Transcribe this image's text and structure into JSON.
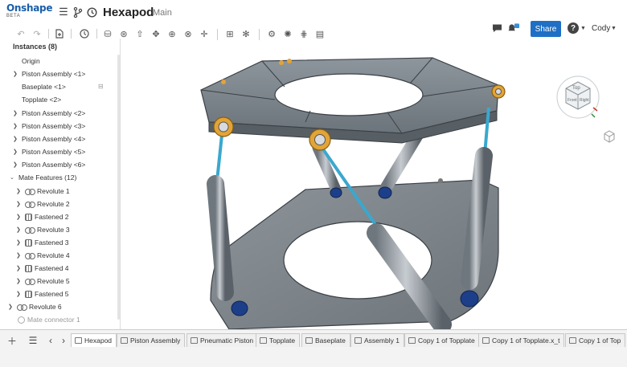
{
  "app": {
    "logo_name": "Onshape",
    "logo_badge": "BETA",
    "document_title": "Hexapod",
    "workspace": "Main",
    "share_label": "Share",
    "user_name": "Cody",
    "accent_color": "#1f6fc5"
  },
  "panel": {
    "header": "Instances (8)",
    "instances": [
      {
        "label": "Origin",
        "expandable": false
      },
      {
        "label": "Piston Assembly <1>",
        "expandable": true
      },
      {
        "label": "Baseplate <1>",
        "expandable": false
      },
      {
        "label": "Topplate <2>",
        "expandable": false
      },
      {
        "label": "Piston Assembly <2>",
        "expandable": true
      },
      {
        "label": "Piston Assembly <3>",
        "expandable": true
      },
      {
        "label": "Piston Assembly <4>",
        "expandable": true
      },
      {
        "label": "Piston Assembly <5>",
        "expandable": true
      },
      {
        "label": "Piston Assembly <6>",
        "expandable": true
      }
    ],
    "mate_header": "Mate Features (12)",
    "mates": [
      {
        "label": "Revolute 1",
        "type": "revolute"
      },
      {
        "label": "Revolute 2",
        "type": "revolute"
      },
      {
        "label": "Fastened 2",
        "type": "fastened"
      },
      {
        "label": "Revolute 3",
        "type": "revolute"
      },
      {
        "label": "Fastened 3",
        "type": "fastened"
      },
      {
        "label": "Revolute 4",
        "type": "revolute"
      },
      {
        "label": "Fastened 4",
        "type": "fastened"
      },
      {
        "label": "Revolute 5",
        "type": "revolute"
      },
      {
        "label": "Fastened 5",
        "type": "fastened"
      },
      {
        "label": "Revolute 6",
        "type": "revolute"
      }
    ],
    "connector": "Mate connector 1"
  },
  "view_cube": {
    "top": "Top",
    "front": "Front",
    "right": "Right"
  },
  "tabs": [
    {
      "label": "Hexapod",
      "active": true
    },
    {
      "label": "Piston Assembly",
      "active": false
    },
    {
      "label": "Pneumatic Piston",
      "active": false
    },
    {
      "label": "Topplate",
      "active": false
    },
    {
      "label": "Baseplate",
      "active": false
    },
    {
      "label": "Assembly 1",
      "active": false
    },
    {
      "label": "Copy 1 of Topplate",
      "active": false
    },
    {
      "label": "Copy 1 of Topplate.x_t",
      "active": false
    },
    {
      "label": "Copy 1 of Top",
      "active": false
    }
  ]
}
